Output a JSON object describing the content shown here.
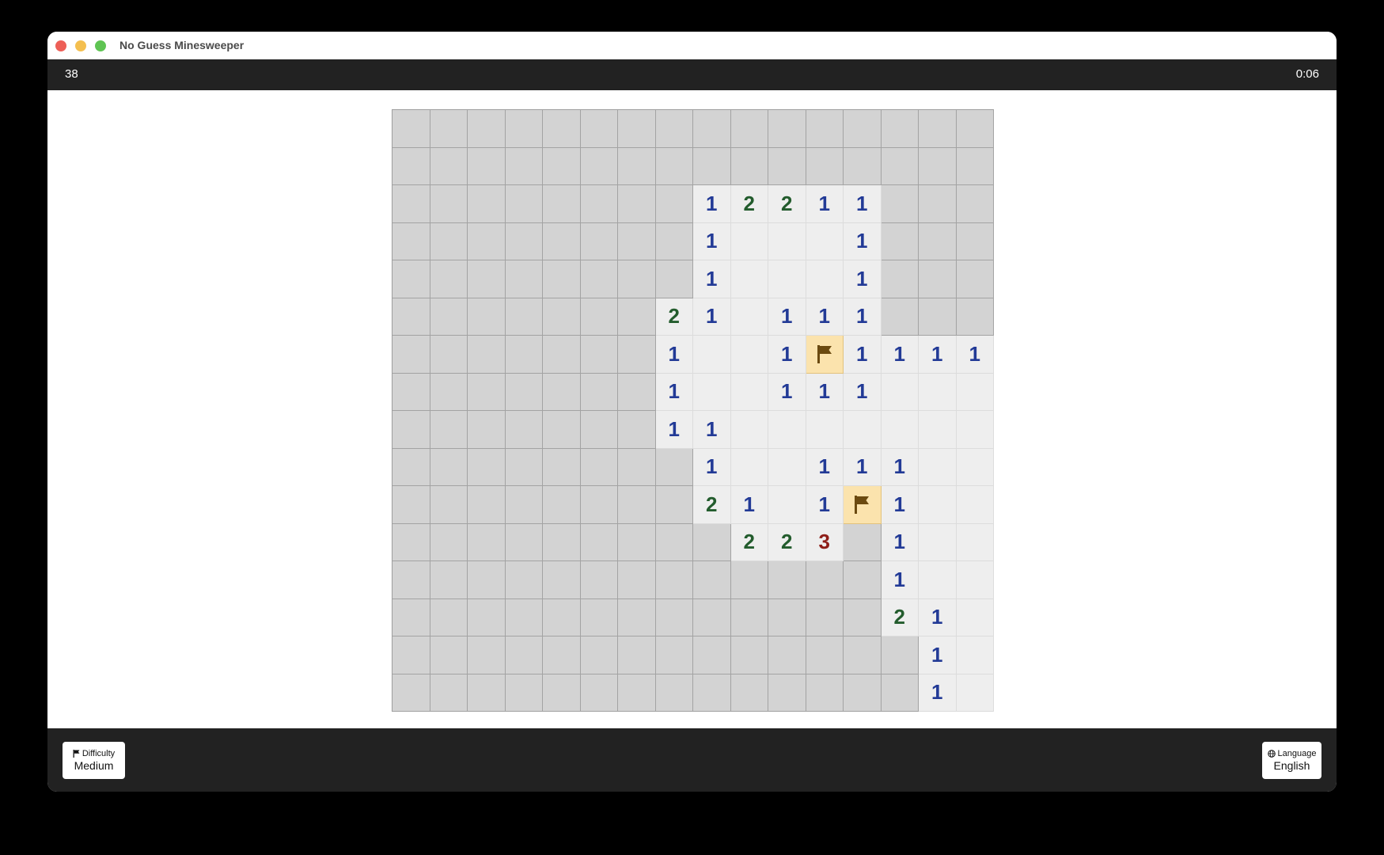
{
  "window": {
    "title": "No Guess Minesweeper"
  },
  "status": {
    "mines_remaining": "38",
    "timer": "0:06"
  },
  "colors": {
    "n1": "#223a96",
    "n2": "#235c2d",
    "n3": "#8e1e18",
    "flag_bg": "#fbe3ad",
    "hidden": "#d3d3d3",
    "open": "#eeeeee"
  },
  "board": {
    "rows": 16,
    "cols": 16,
    "legend": "# hidden, . open empty, F flagged, digits = revealed number",
    "grid": [
      "################",
      "################",
      "########12211###",
      "########1...1###",
      "########1...1###",
      "#######21.111###",
      "#######1..1F1111",
      "#######1..111...",
      "#######11.......",
      "########1..111..",
      "########21.1F1..",
      "#########223#1..",
      "#############1..",
      "#############21.",
      "##############1.",
      "##############1."
    ]
  },
  "footer": {
    "difficulty": {
      "icon": "flag-icon",
      "label": "Difficulty",
      "value": "Medium"
    },
    "language": {
      "icon": "globe-icon",
      "label": "Language",
      "value": "English"
    }
  }
}
